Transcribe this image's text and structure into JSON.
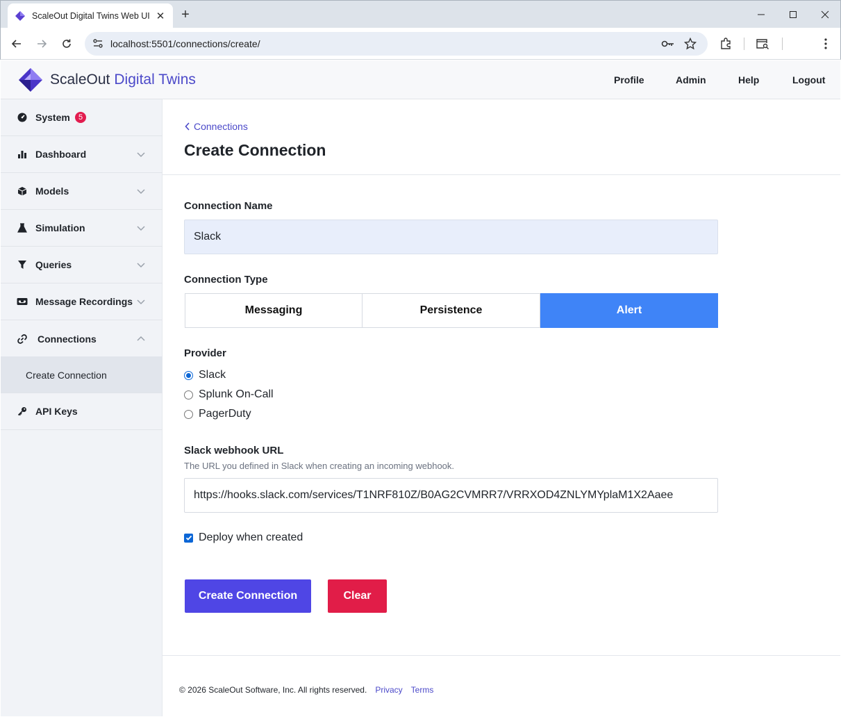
{
  "browser": {
    "tab_title": "ScaleOut Digital Twins Web UI",
    "url": "localhost:5501/connections/create/"
  },
  "header": {
    "brand_part1": "ScaleOut",
    "brand_part2": "Digital Twins",
    "nav": [
      "Profile",
      "Admin",
      "Help",
      "Logout"
    ]
  },
  "sidebar": {
    "items": [
      {
        "label": "System",
        "icon": "gauge-icon",
        "badge": "5"
      },
      {
        "label": "Dashboard",
        "icon": "bar-chart-icon"
      },
      {
        "label": "Models",
        "icon": "cube-icon"
      },
      {
        "label": "Simulation",
        "icon": "flask-icon"
      },
      {
        "label": "Queries",
        "icon": "filter-icon"
      },
      {
        "label": "Message Recordings",
        "icon": "recording-icon"
      },
      {
        "label": "Connections",
        "icon": "link-icon"
      },
      {
        "label": "API Keys",
        "icon": "key-icon"
      }
    ],
    "subitem": "Create Connection"
  },
  "main": {
    "back_link": "Connections",
    "title": "Create Connection",
    "name_label": "Connection Name",
    "name_value": "Slack",
    "type_label": "Connection Type",
    "types": [
      "Messaging",
      "Persistence",
      "Alert"
    ],
    "active_type": "Alert",
    "provider_label": "Provider",
    "providers": [
      "Slack",
      "Splunk On-Call",
      "PagerDuty"
    ],
    "selected_provider": "Slack",
    "webhook_label": "Slack webhook URL",
    "webhook_help": "The URL you defined in Slack when creating an incoming webhook.",
    "webhook_value": "https://hooks.slack.com/services/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",
    "deploy_label": "Deploy when created",
    "deploy_checked": true,
    "create_button": "Create Connection",
    "clear_button": "Clear"
  },
  "footer": {
    "copyright": "© 2026 ScaleOut Software, Inc. All rights reserved.",
    "privacy": "Privacy",
    "terms": "Terms"
  },
  "colors": {
    "accent": "#4f46e5",
    "active_segment": "#3f84f7",
    "danger": "#e11d48",
    "badge": "#e21c4f"
  }
}
